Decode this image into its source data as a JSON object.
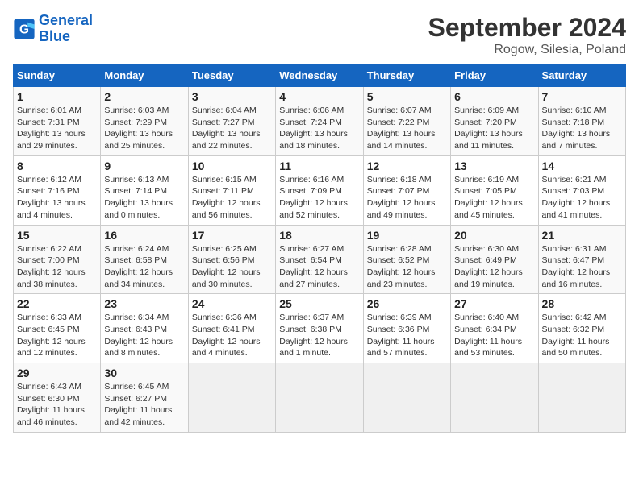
{
  "header": {
    "logo_line1": "General",
    "logo_line2": "Blue",
    "title": "September 2024",
    "subtitle": "Rogow, Silesia, Poland"
  },
  "days_of_week": [
    "Sunday",
    "Monday",
    "Tuesday",
    "Wednesday",
    "Thursday",
    "Friday",
    "Saturday"
  ],
  "weeks": [
    [
      {
        "day": "1",
        "info": "Sunrise: 6:01 AM\nSunset: 7:31 PM\nDaylight: 13 hours\nand 29 minutes."
      },
      {
        "day": "2",
        "info": "Sunrise: 6:03 AM\nSunset: 7:29 PM\nDaylight: 13 hours\nand 25 minutes."
      },
      {
        "day": "3",
        "info": "Sunrise: 6:04 AM\nSunset: 7:27 PM\nDaylight: 13 hours\nand 22 minutes."
      },
      {
        "day": "4",
        "info": "Sunrise: 6:06 AM\nSunset: 7:24 PM\nDaylight: 13 hours\nand 18 minutes."
      },
      {
        "day": "5",
        "info": "Sunrise: 6:07 AM\nSunset: 7:22 PM\nDaylight: 13 hours\nand 14 minutes."
      },
      {
        "day": "6",
        "info": "Sunrise: 6:09 AM\nSunset: 7:20 PM\nDaylight: 13 hours\nand 11 minutes."
      },
      {
        "day": "7",
        "info": "Sunrise: 6:10 AM\nSunset: 7:18 PM\nDaylight: 13 hours\nand 7 minutes."
      }
    ],
    [
      {
        "day": "8",
        "info": "Sunrise: 6:12 AM\nSunset: 7:16 PM\nDaylight: 13 hours\nand 4 minutes."
      },
      {
        "day": "9",
        "info": "Sunrise: 6:13 AM\nSunset: 7:14 PM\nDaylight: 13 hours\nand 0 minutes."
      },
      {
        "day": "10",
        "info": "Sunrise: 6:15 AM\nSunset: 7:11 PM\nDaylight: 12 hours\nand 56 minutes."
      },
      {
        "day": "11",
        "info": "Sunrise: 6:16 AM\nSunset: 7:09 PM\nDaylight: 12 hours\nand 52 minutes."
      },
      {
        "day": "12",
        "info": "Sunrise: 6:18 AM\nSunset: 7:07 PM\nDaylight: 12 hours\nand 49 minutes."
      },
      {
        "day": "13",
        "info": "Sunrise: 6:19 AM\nSunset: 7:05 PM\nDaylight: 12 hours\nand 45 minutes."
      },
      {
        "day": "14",
        "info": "Sunrise: 6:21 AM\nSunset: 7:03 PM\nDaylight: 12 hours\nand 41 minutes."
      }
    ],
    [
      {
        "day": "15",
        "info": "Sunrise: 6:22 AM\nSunset: 7:00 PM\nDaylight: 12 hours\nand 38 minutes."
      },
      {
        "day": "16",
        "info": "Sunrise: 6:24 AM\nSunset: 6:58 PM\nDaylight: 12 hours\nand 34 minutes."
      },
      {
        "day": "17",
        "info": "Sunrise: 6:25 AM\nSunset: 6:56 PM\nDaylight: 12 hours\nand 30 minutes."
      },
      {
        "day": "18",
        "info": "Sunrise: 6:27 AM\nSunset: 6:54 PM\nDaylight: 12 hours\nand 27 minutes."
      },
      {
        "day": "19",
        "info": "Sunrise: 6:28 AM\nSunset: 6:52 PM\nDaylight: 12 hours\nand 23 minutes."
      },
      {
        "day": "20",
        "info": "Sunrise: 6:30 AM\nSunset: 6:49 PM\nDaylight: 12 hours\nand 19 minutes."
      },
      {
        "day": "21",
        "info": "Sunrise: 6:31 AM\nSunset: 6:47 PM\nDaylight: 12 hours\nand 16 minutes."
      }
    ],
    [
      {
        "day": "22",
        "info": "Sunrise: 6:33 AM\nSunset: 6:45 PM\nDaylight: 12 hours\nand 12 minutes."
      },
      {
        "day": "23",
        "info": "Sunrise: 6:34 AM\nSunset: 6:43 PM\nDaylight: 12 hours\nand 8 minutes."
      },
      {
        "day": "24",
        "info": "Sunrise: 6:36 AM\nSunset: 6:41 PM\nDaylight: 12 hours\nand 4 minutes."
      },
      {
        "day": "25",
        "info": "Sunrise: 6:37 AM\nSunset: 6:38 PM\nDaylight: 12 hours\nand 1 minute."
      },
      {
        "day": "26",
        "info": "Sunrise: 6:39 AM\nSunset: 6:36 PM\nDaylight: 11 hours\nand 57 minutes."
      },
      {
        "day": "27",
        "info": "Sunrise: 6:40 AM\nSunset: 6:34 PM\nDaylight: 11 hours\nand 53 minutes."
      },
      {
        "day": "28",
        "info": "Sunrise: 6:42 AM\nSunset: 6:32 PM\nDaylight: 11 hours\nand 50 minutes."
      }
    ],
    [
      {
        "day": "29",
        "info": "Sunrise: 6:43 AM\nSunset: 6:30 PM\nDaylight: 11 hours\nand 46 minutes."
      },
      {
        "day": "30",
        "info": "Sunrise: 6:45 AM\nSunset: 6:27 PM\nDaylight: 11 hours\nand 42 minutes."
      },
      {
        "day": "",
        "info": ""
      },
      {
        "day": "",
        "info": ""
      },
      {
        "day": "",
        "info": ""
      },
      {
        "day": "",
        "info": ""
      },
      {
        "day": "",
        "info": ""
      }
    ]
  ]
}
